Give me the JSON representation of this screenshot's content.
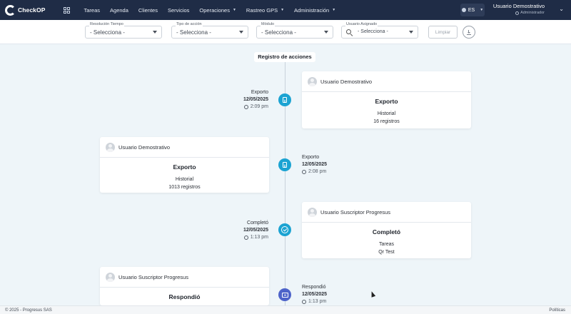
{
  "navbar": {
    "brand": "CheckOP",
    "items": [
      {
        "label": "Tareas",
        "dropdown": false
      },
      {
        "label": "Agenda",
        "dropdown": false
      },
      {
        "label": "Clientes",
        "dropdown": false
      },
      {
        "label": "Servicios",
        "dropdown": false
      },
      {
        "label": "Operaciones",
        "dropdown": true
      },
      {
        "label": "Rastreo GPS",
        "dropdown": true
      },
      {
        "label": "Administración",
        "dropdown": true
      }
    ],
    "language": "ES",
    "user_name": "Usuario Demostrativo",
    "user_role": "Administrador"
  },
  "filters": {
    "resolution": {
      "label": "Resolución Tiempo",
      "value": "- Selecciona -"
    },
    "action_type": {
      "label": "Tipo de acción",
      "value": "- Selecciona -"
    },
    "module": {
      "label": "Módulo",
      "value": "- Selecciona -"
    },
    "assigned_user": {
      "label": "Usuario Asignado",
      "value": "- Selecciona -"
    },
    "clear_label": "Limpiar"
  },
  "timeline": {
    "title": "Registro de acciones",
    "events": [
      {
        "action": "Exporto",
        "date": "12/05/2025",
        "time": "2:09 pm",
        "user": "Usuario Demostrativo",
        "card_title": "Exporto",
        "lines": [
          "Historial",
          "16 registros"
        ]
      },
      {
        "action": "Exporto",
        "date": "12/05/2025",
        "time": "2:08 pm",
        "user": "Usuario Demostrativo",
        "card_title": "Exporto",
        "lines": [
          "Historial",
          "1013 registros"
        ]
      },
      {
        "action": "Completó",
        "date": "12/05/2025",
        "time": "1:13 pm",
        "user": "Usuario Suscriptor Progresus",
        "card_title": "Completó",
        "lines": [
          "Tareas",
          "Qr Test"
        ]
      },
      {
        "action": "Respondió",
        "date": "12/05/2025",
        "time": "1:13 pm",
        "user": "Usuario Suscriptor Progresus",
        "card_title": "Respondió",
        "lines": []
      }
    ]
  },
  "footer": {
    "copyright": "© 2025 - Progresus SAS",
    "policies": "Políticas"
  },
  "colors": {
    "navbar": "#1f2c46",
    "node_teal": "#1ba3d2",
    "node_indigo": "#4d63c9"
  }
}
